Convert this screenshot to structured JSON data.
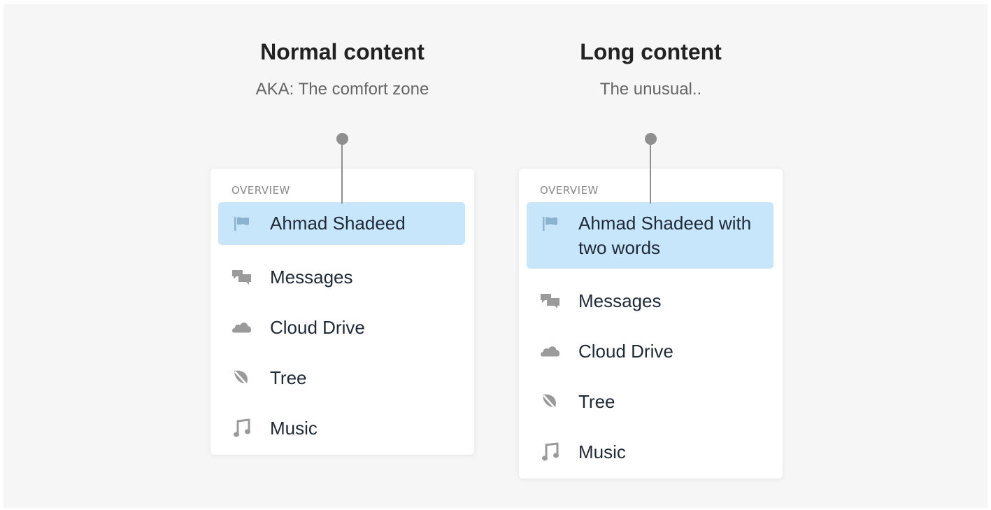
{
  "columns": [
    {
      "title": "Normal content",
      "subtitle": "AKA: The comfort zone",
      "section_label": "OVERVIEW",
      "items": [
        {
          "label": "Ahmad Shadeed",
          "icon": "flag-icon",
          "active": true
        },
        {
          "label": "Messages",
          "icon": "chat-bubbles-icon",
          "active": false
        },
        {
          "label": "Cloud Drive",
          "icon": "cloud-icon",
          "active": false
        },
        {
          "label": "Tree",
          "icon": "leaf-icon",
          "active": false
        },
        {
          "label": "Music",
          "icon": "music-note-icon",
          "active": false
        }
      ]
    },
    {
      "title": "Long content",
      "subtitle": "The unusual..",
      "section_label": "OVERVIEW",
      "items": [
        {
          "label": "Ahmad Shadeed with two words",
          "icon": "flag-icon",
          "active": true
        },
        {
          "label": "Messages",
          "icon": "chat-bubbles-icon",
          "active": false
        },
        {
          "label": "Cloud Drive",
          "icon": "cloud-icon",
          "active": false
        },
        {
          "label": "Tree",
          "icon": "leaf-icon",
          "active": false
        },
        {
          "label": "Music",
          "icon": "music-note-icon",
          "active": false
        }
      ]
    }
  ],
  "colors": {
    "background": "#f6f6f6",
    "card": "#ffffff",
    "active_item": "#c7e6fb",
    "active_icon": "#8bb3cf",
    "icon": "#9a9a9a",
    "pin": "#8f8f8f",
    "title": "#222222",
    "subtitle": "#666666",
    "label": "#1f2a36"
  }
}
